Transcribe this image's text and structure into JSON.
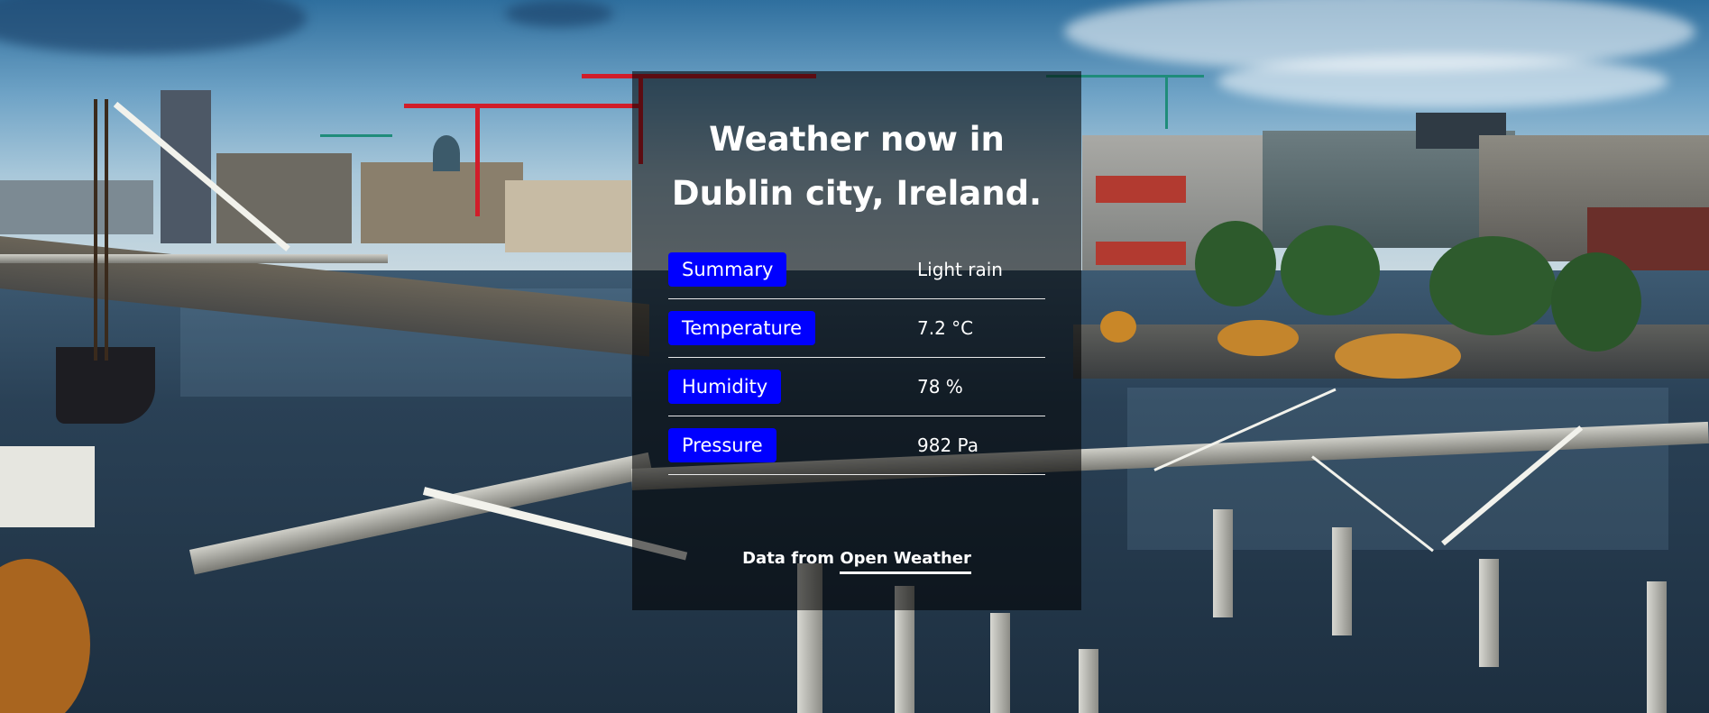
{
  "page": {
    "title_line1": "Weather now in",
    "title_line2": "Dublin city, Ireland."
  },
  "weather": {
    "rows": [
      {
        "label": "Summary",
        "value": "Light rain"
      },
      {
        "label": "Temperature",
        "value": "7.2 °C"
      },
      {
        "label": "Humidity",
        "value": "78 %"
      },
      {
        "label": "Pressure",
        "value": "982 Pa"
      }
    ]
  },
  "footer": {
    "prefix": "Data from",
    "link_text": "Open Weather"
  },
  "colors": {
    "label_background": "#0000ff",
    "panel_overlay": "rgba(0,0,0,0.56)",
    "text": "#ffffff"
  },
  "background": {
    "subject": "photo-background"
  }
}
